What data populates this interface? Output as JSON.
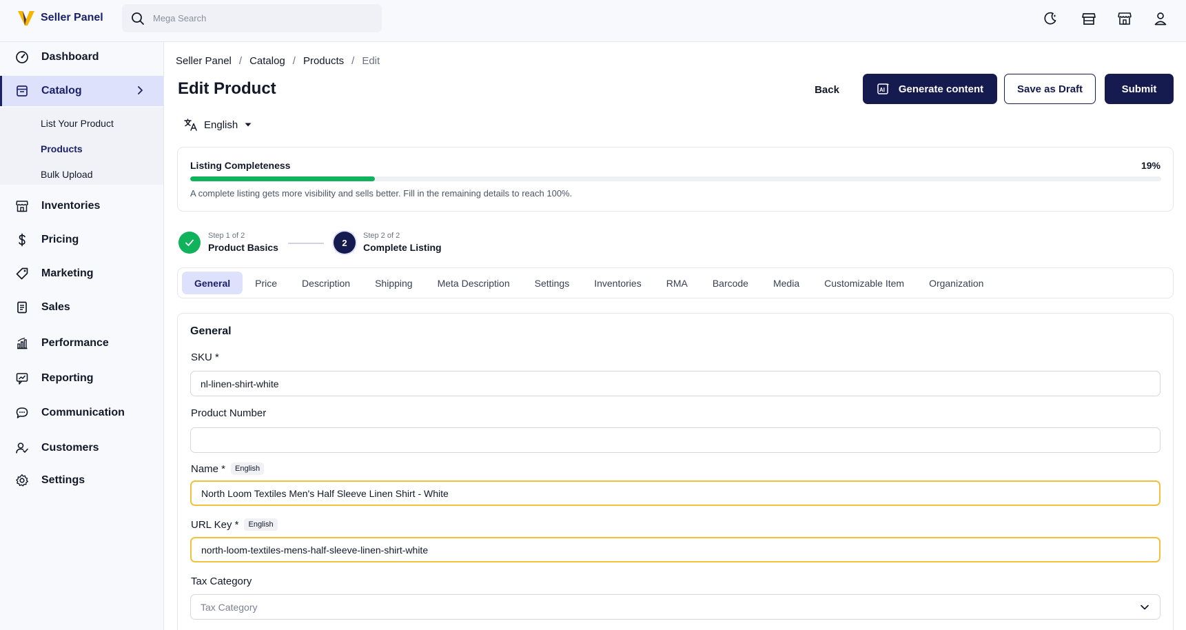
{
  "topbar": {
    "brand": "Seller Panel",
    "search_placeholder": "Mega Search",
    "icons": [
      "theme-toggle-icon",
      "storefront-icon",
      "store-icon",
      "user-icon"
    ]
  },
  "sidebar": {
    "items": [
      {
        "label": "Dashboard",
        "icon": "dashboard-icon"
      },
      {
        "label": "Catalog",
        "icon": "catalog-icon"
      },
      {
        "label": "Inventories",
        "icon": "inventories-icon"
      },
      {
        "label": "Pricing",
        "icon": "dollar-icon"
      },
      {
        "label": "Marketing",
        "icon": "tag-icon"
      },
      {
        "label": "Sales",
        "icon": "sales-icon"
      },
      {
        "label": "Performance",
        "icon": "performance-icon"
      },
      {
        "label": "Reporting",
        "icon": "reporting-icon"
      },
      {
        "label": "Communication",
        "icon": "chat-icon"
      },
      {
        "label": "Customers",
        "icon": "customers-icon"
      },
      {
        "label": "Settings",
        "icon": "gear-icon"
      }
    ],
    "catalog_sub": [
      "List Your Product",
      "Products",
      "Bulk Upload"
    ]
  },
  "breadcrumb": [
    "Seller Panel",
    "Catalog",
    "Products",
    "Edit"
  ],
  "page_title": "Edit Product",
  "actions": {
    "back": "Back",
    "generate": "Generate content",
    "draft": "Save as Draft",
    "submit": "Submit"
  },
  "language": "English",
  "completeness": {
    "title": "Listing Completeness",
    "percent_label": "19%",
    "percent": 19,
    "hint": "A complete listing gets more visibility and sells better. Fill in the remaining details to reach 100%."
  },
  "steps": [
    {
      "small": "Step 1 of 2",
      "label": "Product Basics",
      "status": "complete"
    },
    {
      "small": "Step 2 of 2",
      "label": "Complete Listing",
      "status": "current",
      "number": "2"
    }
  ],
  "tabs": [
    "General",
    "Price",
    "Description",
    "Shipping",
    "Meta Description",
    "Settings",
    "Inventories",
    "RMA",
    "Barcode",
    "Media",
    "Customizable Item",
    "Organization"
  ],
  "form": {
    "section_title": "General",
    "sku": {
      "label": "SKU *",
      "value": "nl-linen-shirt-white"
    },
    "product_number": {
      "label": "Product Number",
      "value": ""
    },
    "name": {
      "label": "Name *",
      "badge": "English",
      "value": "North Loom Textiles Men's Half Sleeve Linen Shirt - White"
    },
    "url_key": {
      "label": "URL Key *",
      "badge": "English",
      "value": "north-loom-textiles-mens-half-sleeve-linen-shirt-white"
    },
    "tax_category": {
      "label": "Tax Category",
      "placeholder": "Tax Category"
    }
  },
  "colors": {
    "brand": "#1b2169",
    "primary_button": "#151a4f",
    "progress": "#10b25c",
    "active_bg": "#dde1fb",
    "highlight_border": "#f3c03b",
    "logo_yellow": "#f7b500"
  }
}
